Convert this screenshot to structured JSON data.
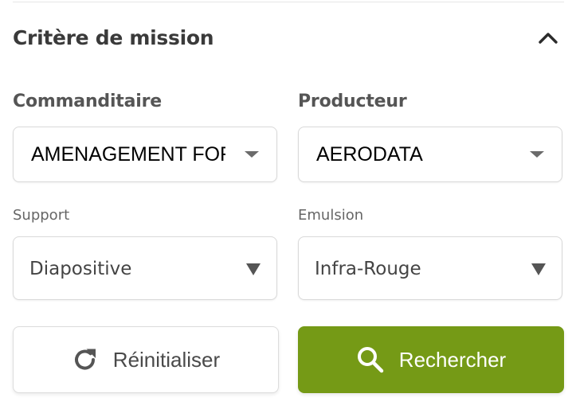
{
  "section": {
    "title": "Critère de mission",
    "toggle_icon": "chevron-up-icon"
  },
  "fields": {
    "commanditaire": {
      "label": "Commanditaire",
      "value": "AMENAGEMENT FORESTIER"
    },
    "producteur": {
      "label": "Producteur",
      "value": "AERODATA"
    },
    "support": {
      "label": "Support",
      "value": "Diapositive"
    },
    "emulsion": {
      "label": "Emulsion",
      "value": "Infra-Rouge"
    }
  },
  "actions": {
    "reset": {
      "label": "Réinitialiser",
      "icon": "refresh-icon"
    },
    "search": {
      "label": "Rechercher",
      "icon": "search-icon"
    }
  },
  "colors": {
    "primary": "#759a16",
    "text": "#333333",
    "border": "#d9d9d9"
  }
}
